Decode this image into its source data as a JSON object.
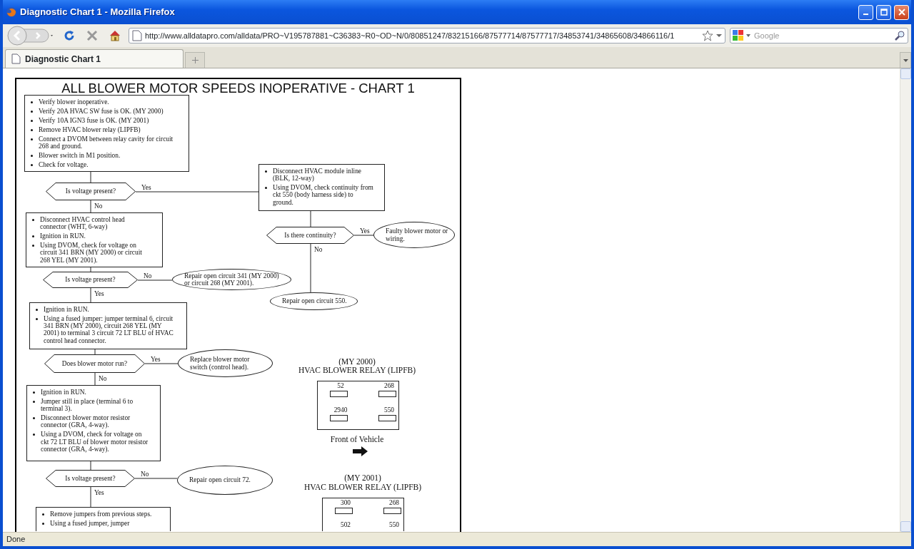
{
  "window": {
    "title": "Diagnostic Chart 1 - Mozilla Firefox"
  },
  "toolbar": {
    "url": "http://www.alldatapro.com/alldata/PRO~V195787881~C36383~R0~OD~N/0/80851247/83215166/87577714/87577717/34853741/34865608/34866116/1",
    "search_placeholder": "Google"
  },
  "tabs": [
    {
      "label": "Diagnostic Chart 1",
      "selected": true
    }
  ],
  "chart": {
    "title": "ALL BLOWER MOTOR SPEEDS INOPERATIVE - CHART 1",
    "nodes": [
      {
        "kind": "steps",
        "items": [
          "Verify blower inoperative.",
          "Verify 20A HVAC SW fuse is OK.  (MY 2000)",
          "Verify 10A IGN3 fuse is OK.  (MY 2001)",
          "Remove HVAC blower relay (LIPFB)",
          "Connect a DVOM between relay cavity for circuit 268 and ground.",
          "Blower switch in M1 position.",
          "Check for voltage."
        ]
      },
      {
        "kind": "decision",
        "text": "Is voltage present?",
        "branches": [
          "Yes",
          "No"
        ]
      },
      {
        "kind": "steps",
        "items": [
          "Disconnect HVAC module inline (BLK, 12-way)",
          "Using DVOM, check continuity from ckt 550 (body harness side) to ground."
        ]
      },
      {
        "kind": "steps",
        "items": [
          "Disconnect HVAC control head connector (WHT, 6-way)",
          "Ignition in RUN.",
          "Using DVOM, check for voltage on circuit 341 BRN (MY 2000) or circuit 268 YEL (MY 2001)."
        ]
      },
      {
        "kind": "decision",
        "text": "Is there continuity?",
        "branches": [
          "Yes",
          "No"
        ]
      },
      {
        "kind": "end",
        "text": "Faulty blower motor or wiring."
      },
      {
        "kind": "decision",
        "text": "Is voltage present?",
        "branches": [
          "No",
          "Yes"
        ]
      },
      {
        "kind": "end",
        "text": "Repair open circuit 341  (MY 2000) or circuit 268 (MY 2001)."
      },
      {
        "kind": "end",
        "text": "Repair open circuit 550."
      },
      {
        "kind": "steps",
        "items": [
          "Ignition in RUN.",
          "Using a fused jumper:  jumper terminal 6, circuit 341 BRN (MY 2000), circuit 268 YEL (MY 2001) to terminal 3 circuit 72 LT BLU of HVAC control head connector."
        ]
      },
      {
        "kind": "decision",
        "text": "Does blower motor run?",
        "branches": [
          "Yes",
          "No"
        ]
      },
      {
        "kind": "end",
        "text": "Replace blower motor switch (control head)."
      },
      {
        "kind": "steps",
        "items": [
          "Ignition in RUN.",
          "Jumper still in place (terminal 6 to terminal 3).",
          "Disconnect blower motor resistor connector (GRA, 4-way).",
          "Using a DVOM, check for voltage on ckt 72 LT BLU of blower motor resistor connector (GRA, 4-way)."
        ]
      },
      {
        "kind": "decision",
        "text": "Is voltage present?",
        "branches": [
          "No",
          "Yes"
        ]
      },
      {
        "kind": "end",
        "text": "Repair open circuit 72."
      },
      {
        "kind": "steps",
        "items": [
          "Remove jumpers from previous steps.",
          "Using a fused jumper, jumper"
        ]
      }
    ],
    "relays": [
      {
        "model_year": "(MY 2000)",
        "title": "HVAC BLOWER RELAY (LIPFB)",
        "terminals": [
          "52",
          "268",
          "2940",
          "550"
        ],
        "note": "Front of Vehicle"
      },
      {
        "model_year": "(MY 2001)",
        "title": "HVAC BLOWER RELAY (LIPFB)",
        "terminals": [
          "300",
          "268",
          "502",
          "550"
        ]
      }
    ]
  },
  "status_bar": "Done"
}
